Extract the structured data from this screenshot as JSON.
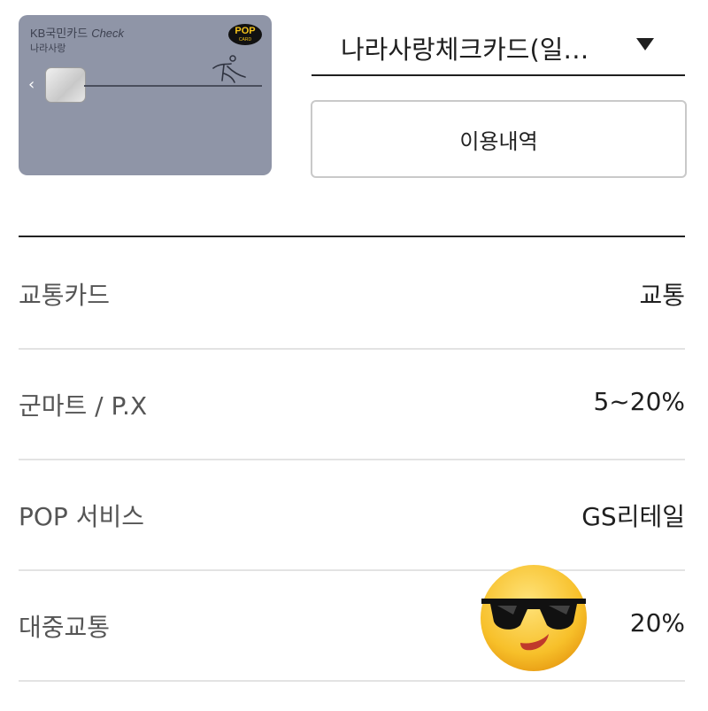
{
  "card": {
    "issuer": "KB국민카드",
    "type": "Check",
    "name": "나라사랑",
    "badge_top": "POP",
    "badge_bottom": "CARD"
  },
  "selector": {
    "selected": "나라사랑체크카드(일…"
  },
  "history_button": {
    "label": "이용내역"
  },
  "benefits": [
    {
      "label": "교통카드",
      "value": "교통"
    },
    {
      "label": "군마트 / P.X",
      "value": "5~20%"
    },
    {
      "label": "POP 서비스",
      "value": "GS리테일"
    },
    {
      "label": "대중교통",
      "value": "20%"
    }
  ],
  "icons": {
    "selector_caret": "caret-down-icon",
    "card_prev": "chevron-left-icon",
    "overlay": "sunglasses-emoji-icon"
  },
  "colors": {
    "card_bg": "#8f95a7",
    "badge_text": "#f3c21b"
  }
}
